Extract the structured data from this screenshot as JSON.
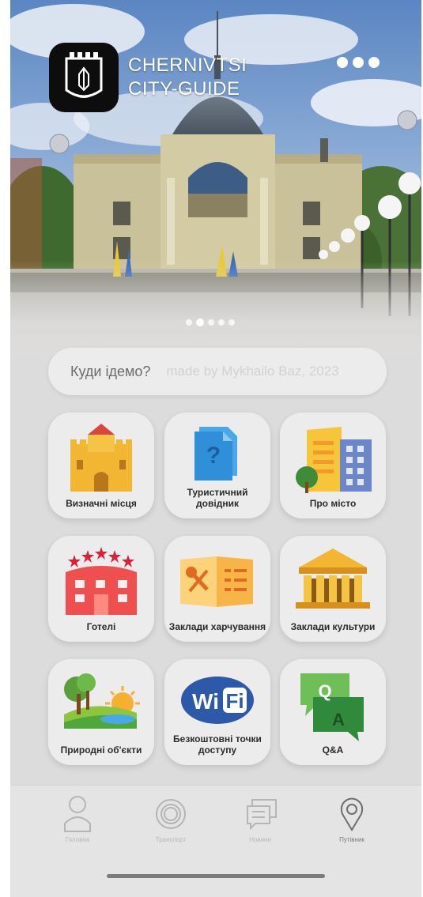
{
  "app": {
    "title_line1": "CHERNIVTSI",
    "title_line2": "CITY-GUIDE"
  },
  "header": {
    "more_icon": "more-horizontal-icon"
  },
  "carousel": {
    "slide_count": 5,
    "active_index": 1
  },
  "search": {
    "label": "Куди ідемо?",
    "credit": "made by Mykhailo Baz, 2023"
  },
  "categories": [
    {
      "label": "Визначні місця",
      "icon": "castle-icon"
    },
    {
      "label": "Туристичний довідник",
      "icon": "question-document-icon"
    },
    {
      "label": "Про місто",
      "icon": "city-buildings-icon"
    },
    {
      "label": "Готелі",
      "icon": "hotel-icon"
    },
    {
      "label": "Заклади харчування",
      "icon": "menu-cutlery-icon"
    },
    {
      "label": "Заклади культури",
      "icon": "museum-icon"
    },
    {
      "label": "Природні об'єкти",
      "icon": "nature-landscape-icon"
    },
    {
      "label": "Безкоштовні точки доступу",
      "icon": "wifi-icon"
    },
    {
      "label": "Q&A",
      "icon": "qa-chat-icon"
    }
  ],
  "tabs": [
    {
      "label": "Головна",
      "icon": "person-icon"
    },
    {
      "label": "Транспорт",
      "icon": "target-icon"
    },
    {
      "label": "Новини",
      "icon": "chat-news-icon"
    },
    {
      "label": "Путівник",
      "icon": "location-pin-icon"
    }
  ],
  "colors": {
    "tile_bg": "#ececec",
    "screen_bg": "#dcdcdc",
    "castle": "#f2b632",
    "hotel": "#ef4f4f",
    "wifi": "#2d5aa8",
    "qa": "#3b9b48",
    "doc": "#4aa8e8"
  }
}
